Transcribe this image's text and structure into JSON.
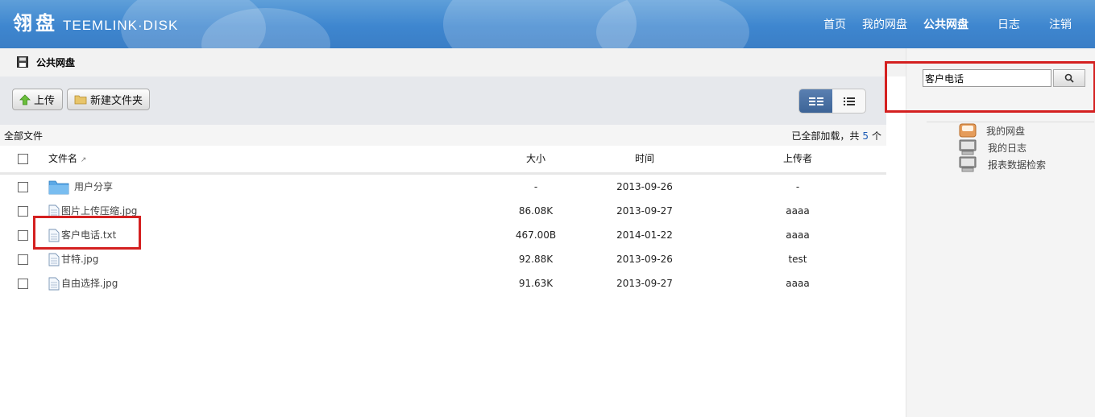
{
  "header": {
    "logo_cn": "翎盘",
    "logo_en": "TEEMLINK·DISK",
    "nav": [
      {
        "label": "首页"
      },
      {
        "label": "我的网盘"
      },
      {
        "label": "公共网盘"
      },
      {
        "label": "日志"
      },
      {
        "label": "注销"
      }
    ]
  },
  "breadcrumb": {
    "label": "公共网盘"
  },
  "toolbar": {
    "upload_label": "上传",
    "new_folder_label": "新建文件夹"
  },
  "info": {
    "all_files": "全部文件",
    "loaded_prefix": "已全部加载，共",
    "count": "5",
    "count_suffix": "个"
  },
  "table": {
    "headers": {
      "name": "文件名",
      "size": "大小",
      "time": "时间",
      "uploader": "上传者"
    },
    "rows": [
      {
        "type": "folder",
        "name": "用户分享",
        "size": "-",
        "time": "2013-09-26",
        "uploader": "-"
      },
      {
        "type": "file",
        "name": "图片上传压缩.jpg",
        "size": "86.08K",
        "time": "2013-09-27",
        "uploader": "aaaa"
      },
      {
        "type": "file",
        "name": "客户电话.txt",
        "size": "467.00B",
        "time": "2014-01-22",
        "uploader": "aaaa"
      },
      {
        "type": "file",
        "name": "甘特.jpg",
        "size": "92.88K",
        "time": "2013-09-26",
        "uploader": "test"
      },
      {
        "type": "file",
        "name": "自由选择.jpg",
        "size": "91.63K",
        "time": "2013-09-27",
        "uploader": "aaaa"
      }
    ]
  },
  "sidebar": {
    "search_value": "客户电话",
    "links": [
      {
        "label": "我的网盘",
        "icon": "disk-icon"
      },
      {
        "label": "我的日志",
        "icon": "monitor-icon"
      },
      {
        "label": "报表数据检索",
        "icon": "monitor-icon"
      }
    ]
  },
  "colors": {
    "header": "#3e86cf",
    "highlight": "#d42020",
    "count": "#1d5bb5",
    "view_active": "#4a70a4"
  }
}
